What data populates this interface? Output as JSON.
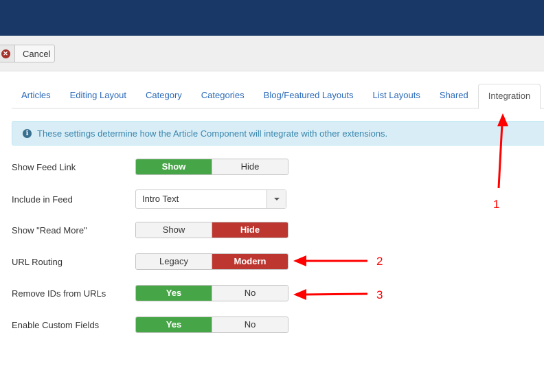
{
  "toolbar": {
    "cancel_label": "Cancel",
    "cancel_icon": "close-circle-icon"
  },
  "tabs": [
    {
      "label": "Articles"
    },
    {
      "label": "Editing Layout"
    },
    {
      "label": "Category"
    },
    {
      "label": "Categories"
    },
    {
      "label": "Blog/Featured Layouts"
    },
    {
      "label": "List Layouts"
    },
    {
      "label": "Shared"
    },
    {
      "label": "Integration",
      "active": true
    }
  ],
  "alert": {
    "icon": "info-icon",
    "text": "These settings determine how the Article Component will integrate with other extensions."
  },
  "fields": {
    "show_feed_link": {
      "label": "Show Feed Link",
      "options": [
        "Show",
        "Hide"
      ],
      "selected": "Show"
    },
    "include_in_feed": {
      "label": "Include in Feed",
      "value": "Intro Text"
    },
    "show_read_more": {
      "label": "Show \"Read More\"",
      "options": [
        "Show",
        "Hide"
      ],
      "selected": "Hide"
    },
    "url_routing": {
      "label": "URL Routing",
      "options": [
        "Legacy",
        "Modern"
      ],
      "selected": "Modern"
    },
    "remove_ids": {
      "label": "Remove IDs from URLs",
      "options": [
        "Yes",
        "No"
      ],
      "selected": "Yes"
    },
    "custom_fields": {
      "label": "Enable Custom Fields",
      "options": [
        "Yes",
        "No"
      ],
      "selected": "Yes"
    }
  },
  "colors": {
    "header": "#1a3867",
    "green": "#46a546",
    "red": "#bd362f",
    "annotation": "#ff0000"
  },
  "annotations": [
    "1",
    "2",
    "3"
  ]
}
